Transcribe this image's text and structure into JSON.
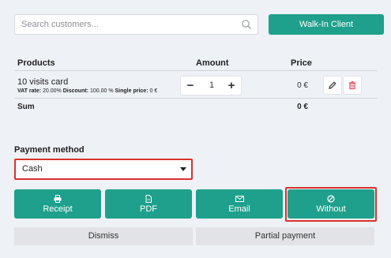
{
  "search": {
    "placeholder": "Search customers..."
  },
  "walk_in_label": "Walk-In Client",
  "table": {
    "headers": {
      "products": "Products",
      "amount": "Amount",
      "price": "Price"
    },
    "item": {
      "name": "10 visits card",
      "vat_label": "VAT rate:",
      "vat_value": "20.00%",
      "discount_label": "Discount:",
      "discount_value": "100.00 %",
      "single_label": "Single price:",
      "single_value": "0 €",
      "quantity": "1",
      "price": "0 €"
    },
    "sum_label": "Sum",
    "sum_value": "0 €"
  },
  "payment": {
    "label": "Payment method",
    "selected": "Cash",
    "buttons": [
      "Receipt",
      "PDF",
      "Email",
      "Without"
    ],
    "dismiss": "Dismiss",
    "partial": "Partial payment"
  },
  "colors": {
    "accent": "#1fa08c",
    "highlight": "#d8322d",
    "delete": "#e0394f"
  },
  "icons": [
    "search-icon",
    "pencil-icon",
    "trash-icon",
    "printer-icon",
    "pdf-file-icon",
    "envelope-icon",
    "no-entry-icon"
  ]
}
